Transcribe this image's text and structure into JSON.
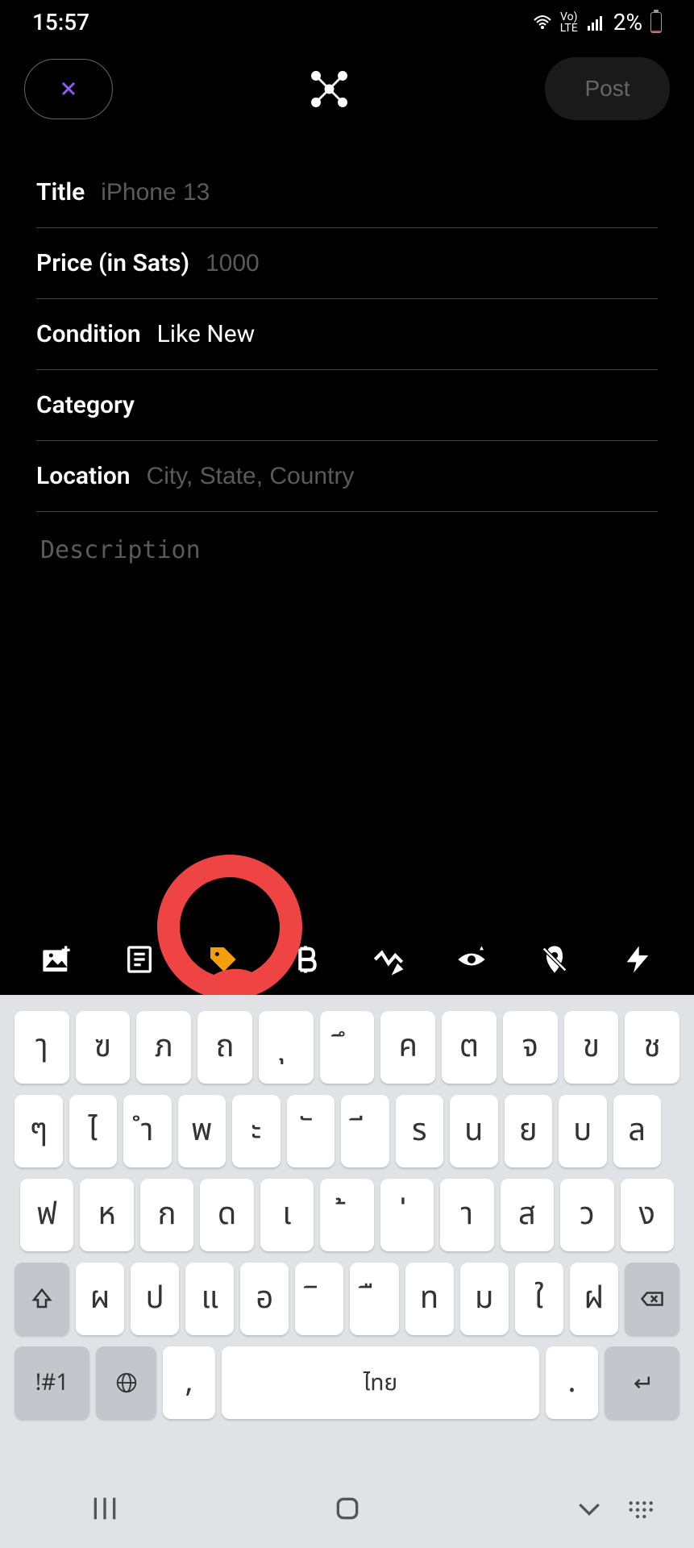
{
  "status": {
    "time": "15:57",
    "battery": "2%",
    "network": "LTE",
    "voice": "Vo)"
  },
  "header": {
    "post_label": "Post"
  },
  "form": {
    "title_label": "Title",
    "title_placeholder": "iPhone 13",
    "price_label": "Price (in Sats)",
    "price_placeholder": "1000",
    "condition_label": "Condition",
    "condition_value": "Like New",
    "category_label": "Category",
    "location_label": "Location",
    "location_placeholder": "City, State, Country",
    "description_placeholder": "Description"
  },
  "keyboard": {
    "row1": [
      "ๅ",
      "ฃ",
      "ภ",
      "ถ",
      "ุ",
      "ึ",
      "ค",
      "ต",
      "จ",
      "ข",
      "ช"
    ],
    "row2": [
      "ๆ",
      "ไ",
      "ำ",
      "พ",
      "ะ",
      "ั",
      "ี",
      "ร",
      "น",
      "ย",
      "บ",
      "ล"
    ],
    "row3": [
      "ฟ",
      "ห",
      "ก",
      "ด",
      "เ",
      "้",
      "่",
      "า",
      "ส",
      "ว",
      "ง"
    ],
    "row4": [
      "ผ",
      "ป",
      "แ",
      "อ",
      "ิ",
      "ื",
      "ท",
      "ม",
      "ใ",
      "ฝ"
    ],
    "symbols": "!#1",
    "comma": ",",
    "space": "ไทย",
    "period": "."
  }
}
